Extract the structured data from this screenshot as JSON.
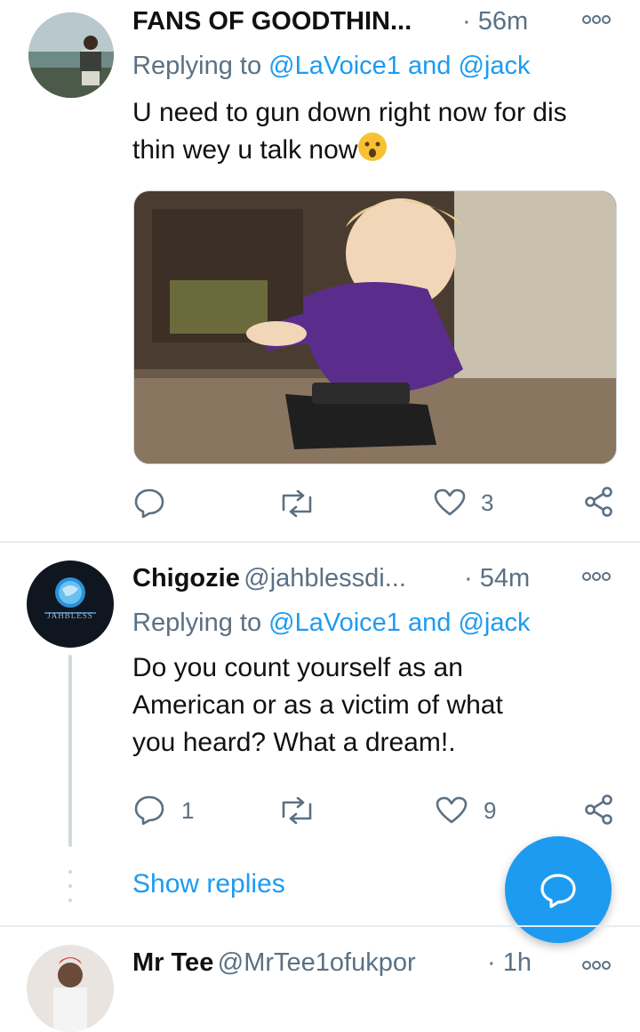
{
  "tweets": [
    {
      "name": "FANS OF GOODTHIN...",
      "time": "56m",
      "replying": "Replying to",
      "mention1": "@LaVoice1",
      "and": "and",
      "mention2": "@jack",
      "text": "U need to gun down right now for dis thin wey u talk now",
      "emoji": "hushed-face-emoji",
      "image_desc": "child-reaching-for-gun-image",
      "likes": "3"
    },
    {
      "name": "Chigozie",
      "handle": "@jahblessdi...",
      "time": "54m",
      "replying": "Replying to",
      "mention1": "@LaVoice1",
      "and": "and",
      "mention2": "@jack",
      "text_lines": [
        "Do you count yourself as an",
        "American or as a victim of what",
        "you heard? What a dream!."
      ],
      "avatar_text": "JAHBLESS",
      "replies": "1",
      "likes": "9"
    },
    {
      "name": "Mr Tee",
      "handle": "@MrTee1ofukpor",
      "time": "1h"
    }
  ],
  "show_replies": "Show replies",
  "dot": "·",
  "colors": {
    "accent": "#1d9bf0",
    "muted": "#5b7083",
    "separator": "#e6ecf0"
  }
}
